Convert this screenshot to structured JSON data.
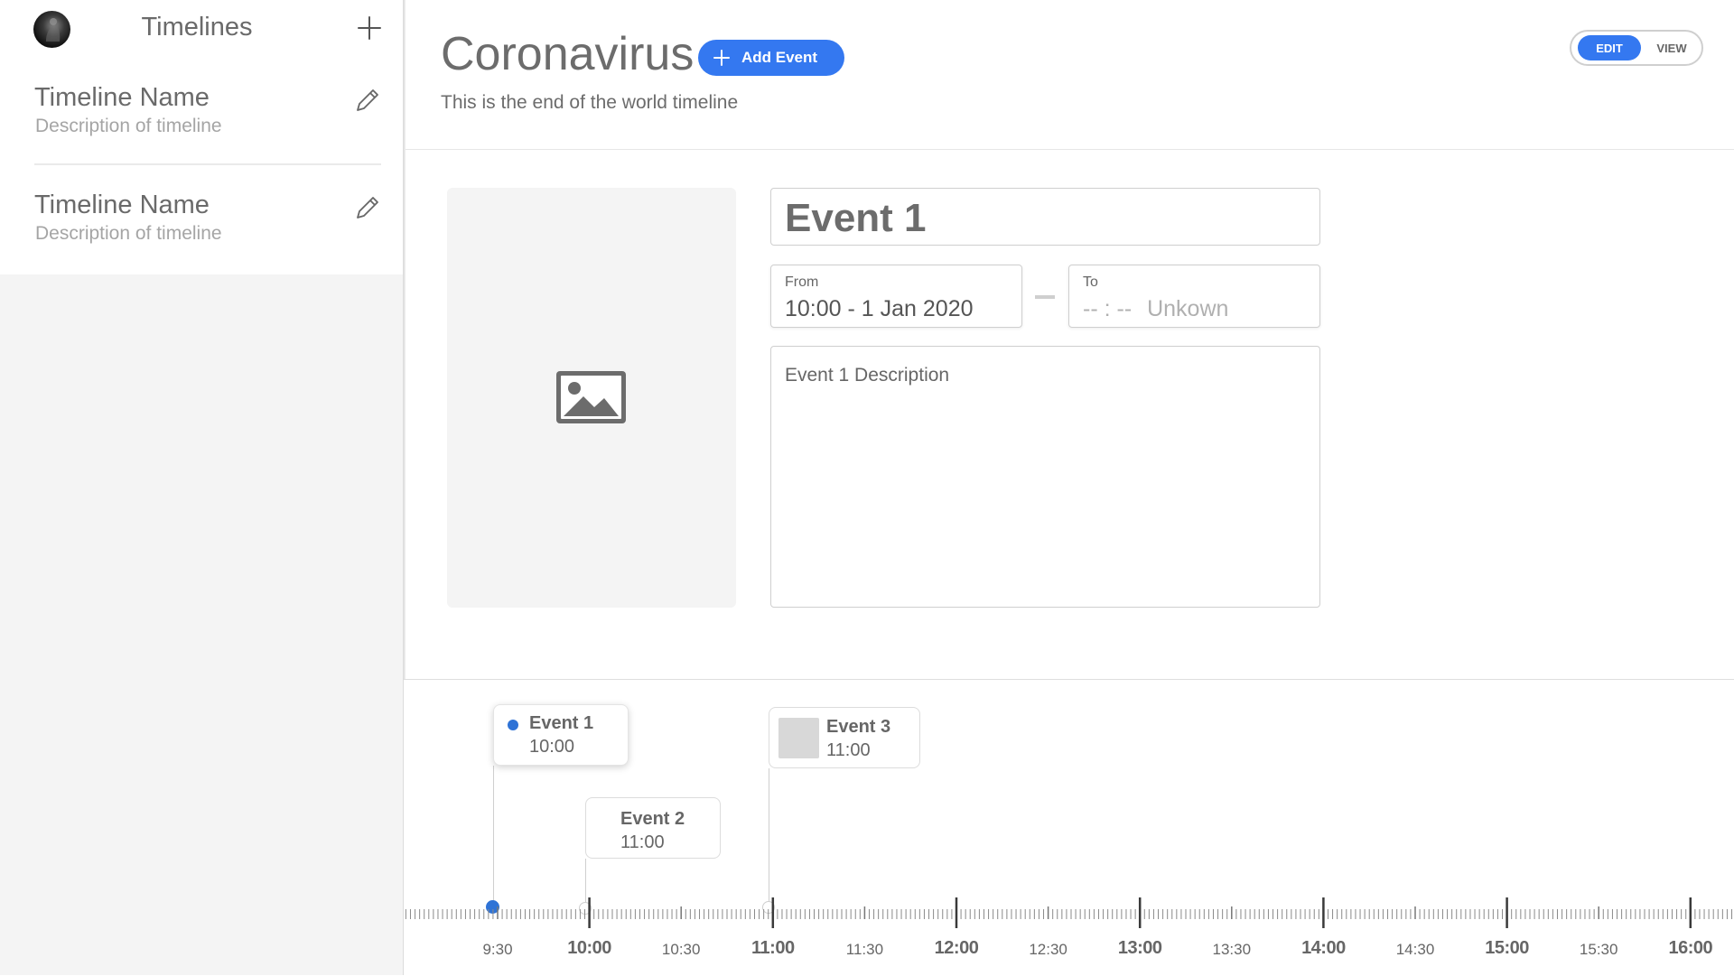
{
  "sidebar": {
    "title": "Timelines",
    "items": [
      {
        "name": "Timeline Name",
        "description": "Description of timeline"
      },
      {
        "name": "Timeline Name",
        "description": "Description of timeline"
      }
    ]
  },
  "header": {
    "title": "Coronavirus",
    "subtitle": "This is the end of the world timeline",
    "add_event_label": "Add Event",
    "mode": {
      "edit_label": "EDIT",
      "view_label": "VIEW",
      "active": "EDIT"
    }
  },
  "editor": {
    "event_title": "Event 1",
    "from": {
      "label": "From",
      "value": "10:00 - 1 Jan 2020"
    },
    "to": {
      "label": "To",
      "placeholder_time": "-- : --",
      "placeholder_text": "Unkown"
    },
    "description": "Event 1 Description"
  },
  "timeline": {
    "events": [
      {
        "title": "Event 1",
        "time": "10:00",
        "selected": true
      },
      {
        "title": "Event 2",
        "time": "11:00",
        "selected": false
      },
      {
        "title": "Event 3",
        "time": "11:00",
        "selected": false
      }
    ],
    "ticks": [
      "9:30",
      "10:00",
      "10:30",
      "11:00",
      "11:30",
      "12:00",
      "12:30",
      "13:00",
      "13:30",
      "14:00",
      "14:30",
      "15:00",
      "15:30",
      "16:00"
    ],
    "accent_color": "#2f73d6"
  },
  "colors": {
    "primary": "#3478f0",
    "accent": "#2f73d6"
  },
  "icons": [
    "avatar",
    "plus-icon",
    "pencil-icon",
    "image-icon"
  ]
}
